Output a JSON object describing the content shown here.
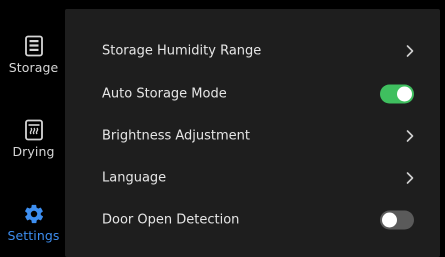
{
  "sidebar": {
    "items": [
      {
        "label": "Storage",
        "icon": "storage-icon",
        "active": false
      },
      {
        "label": "Drying",
        "icon": "drying-icon",
        "active": false
      },
      {
        "label": "Settings",
        "icon": "gear-icon",
        "active": true
      }
    ]
  },
  "settings": {
    "rows": [
      {
        "label": "Storage Humidity Range",
        "control": "chevron-right-icon"
      },
      {
        "label": "Auto Storage Mode",
        "control": "toggle",
        "value": true
      },
      {
        "label": "Brightness Adjustment",
        "control": "chevron-right-icon"
      },
      {
        "label": "Language",
        "control": "chevron-right-icon"
      },
      {
        "label": "Door Open Detection",
        "control": "toggle",
        "value": false
      }
    ]
  },
  "colors": {
    "accent": "#3d8ef0",
    "toggle_on": "#3fbf5f",
    "toggle_off": "#5a5a5a",
    "panel_bg": "#1e1e1e",
    "background": "#000000"
  }
}
